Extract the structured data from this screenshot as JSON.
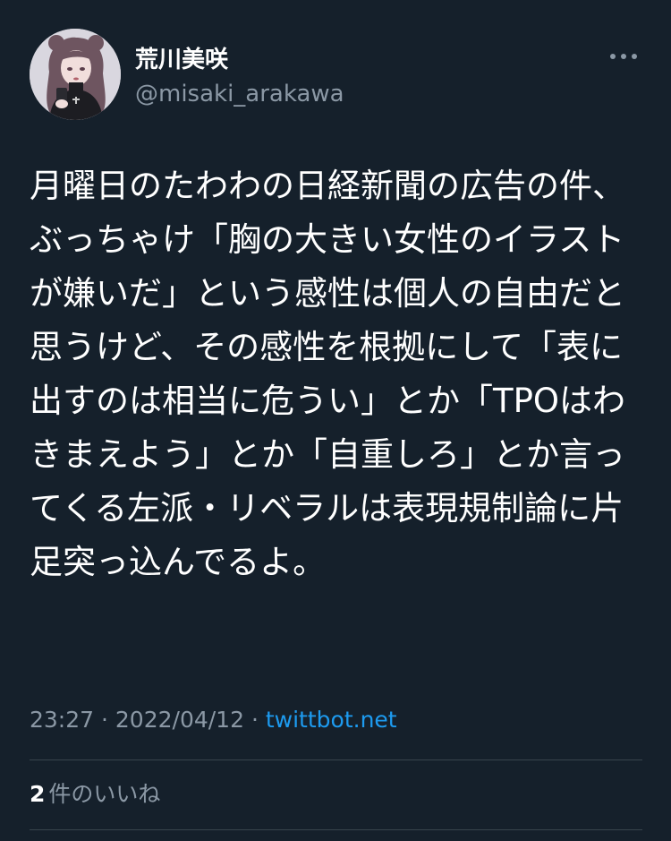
{
  "author": {
    "display_name": "荒川美咲",
    "handle": "@misaki_arakawa",
    "avatar_icon": "avatar-illustration"
  },
  "header": {
    "more_icon": "more-horizontal-icon"
  },
  "tweet": {
    "text": "月曜日のたわわの日経新聞の広告の件、ぶっちゃけ「胸の大きい女性のイラストが嫌いだ」という感性は個人の自由だと思うけど、その感性を根拠にして「表に出すのは相当に危うい」とか「TPOはわきまえよう」とか「自重しろ」とか言ってくる左派・リベラルは表現規制論に片足突っ込んでるよ。"
  },
  "meta": {
    "time": "23:27",
    "separator1": "·",
    "date": "2022/04/12",
    "separator2": "·",
    "source": "twittbot.net"
  },
  "likes": {
    "count": "2",
    "label": "件のいいね"
  },
  "colors": {
    "background": "#15202b",
    "primary_text": "#ffffff",
    "secondary_text": "#8b98a5",
    "link": "#1d9bf0",
    "divider": "#38444d"
  }
}
